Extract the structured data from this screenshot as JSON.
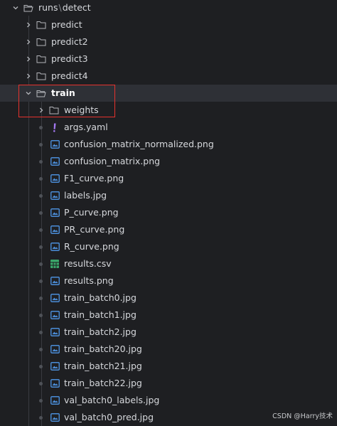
{
  "root": {
    "segment1": "runs",
    "separator": "\\",
    "segment2": "detect"
  },
  "folders": [
    {
      "label": "predict"
    },
    {
      "label": "predict2"
    },
    {
      "label": "predict3"
    },
    {
      "label": "predict4"
    }
  ],
  "train": {
    "label": "train",
    "expanded": true,
    "weights": {
      "label": "weights"
    },
    "files": [
      {
        "label": "args.yaml",
        "icon": "exclamation-yaml-icon"
      },
      {
        "label": "confusion_matrix_normalized.png",
        "icon": "image-icon"
      },
      {
        "label": "confusion_matrix.png",
        "icon": "image-icon"
      },
      {
        "label": "F1_curve.png",
        "icon": "image-icon"
      },
      {
        "label": "labels.jpg",
        "icon": "image-icon"
      },
      {
        "label": "P_curve.png",
        "icon": "image-icon"
      },
      {
        "label": "PR_curve.png",
        "icon": "image-icon"
      },
      {
        "label": "R_curve.png",
        "icon": "image-icon"
      },
      {
        "label": "results.csv",
        "icon": "table-icon"
      },
      {
        "label": "results.png",
        "icon": "image-icon"
      },
      {
        "label": "train_batch0.jpg",
        "icon": "image-icon"
      },
      {
        "label": "train_batch1.jpg",
        "icon": "image-icon"
      },
      {
        "label": "train_batch2.jpg",
        "icon": "image-icon"
      },
      {
        "label": "train_batch20.jpg",
        "icon": "image-icon"
      },
      {
        "label": "train_batch21.jpg",
        "icon": "image-icon"
      },
      {
        "label": "train_batch22.jpg",
        "icon": "image-icon"
      },
      {
        "label": "val_batch0_labels.jpg",
        "icon": "image-icon"
      },
      {
        "label": "val_batch0_pred.jpg",
        "icon": "image-icon"
      }
    ]
  },
  "colors": {
    "background": "#1e1f22",
    "selected_row": "#2e3036",
    "highlight_box": "#e5322d",
    "image_icon": "#4b8dd8",
    "yaml_icon": "#a378f0",
    "csv_icon": "#3aa66a"
  },
  "watermark": "CSDN @Harry技术"
}
